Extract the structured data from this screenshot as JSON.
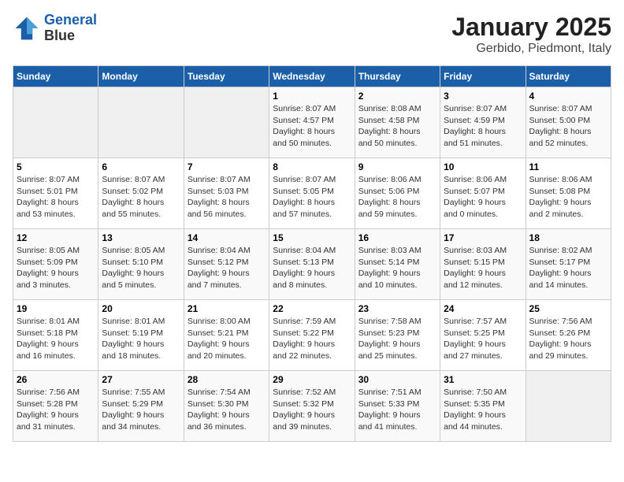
{
  "header": {
    "logo_line1": "General",
    "logo_line2": "Blue",
    "month": "January 2025",
    "location": "Gerbido, Piedmont, Italy"
  },
  "weekdays": [
    "Sunday",
    "Monday",
    "Tuesday",
    "Wednesday",
    "Thursday",
    "Friday",
    "Saturday"
  ],
  "weeks": [
    [
      {
        "day": "",
        "info": ""
      },
      {
        "day": "",
        "info": ""
      },
      {
        "day": "",
        "info": ""
      },
      {
        "day": "1",
        "info": "Sunrise: 8:07 AM\nSunset: 4:57 PM\nDaylight: 8 hours\nand 50 minutes."
      },
      {
        "day": "2",
        "info": "Sunrise: 8:08 AM\nSunset: 4:58 PM\nDaylight: 8 hours\nand 50 minutes."
      },
      {
        "day": "3",
        "info": "Sunrise: 8:07 AM\nSunset: 4:59 PM\nDaylight: 8 hours\nand 51 minutes."
      },
      {
        "day": "4",
        "info": "Sunrise: 8:07 AM\nSunset: 5:00 PM\nDaylight: 8 hours\nand 52 minutes."
      }
    ],
    [
      {
        "day": "5",
        "info": "Sunrise: 8:07 AM\nSunset: 5:01 PM\nDaylight: 8 hours\nand 53 minutes."
      },
      {
        "day": "6",
        "info": "Sunrise: 8:07 AM\nSunset: 5:02 PM\nDaylight: 8 hours\nand 55 minutes."
      },
      {
        "day": "7",
        "info": "Sunrise: 8:07 AM\nSunset: 5:03 PM\nDaylight: 8 hours\nand 56 minutes."
      },
      {
        "day": "8",
        "info": "Sunrise: 8:07 AM\nSunset: 5:05 PM\nDaylight: 8 hours\nand 57 minutes."
      },
      {
        "day": "9",
        "info": "Sunrise: 8:06 AM\nSunset: 5:06 PM\nDaylight: 8 hours\nand 59 minutes."
      },
      {
        "day": "10",
        "info": "Sunrise: 8:06 AM\nSunset: 5:07 PM\nDaylight: 9 hours\nand 0 minutes."
      },
      {
        "day": "11",
        "info": "Sunrise: 8:06 AM\nSunset: 5:08 PM\nDaylight: 9 hours\nand 2 minutes."
      }
    ],
    [
      {
        "day": "12",
        "info": "Sunrise: 8:05 AM\nSunset: 5:09 PM\nDaylight: 9 hours\nand 3 minutes."
      },
      {
        "day": "13",
        "info": "Sunrise: 8:05 AM\nSunset: 5:10 PM\nDaylight: 9 hours\nand 5 minutes."
      },
      {
        "day": "14",
        "info": "Sunrise: 8:04 AM\nSunset: 5:12 PM\nDaylight: 9 hours\nand 7 minutes."
      },
      {
        "day": "15",
        "info": "Sunrise: 8:04 AM\nSunset: 5:13 PM\nDaylight: 9 hours\nand 8 minutes."
      },
      {
        "day": "16",
        "info": "Sunrise: 8:03 AM\nSunset: 5:14 PM\nDaylight: 9 hours\nand 10 minutes."
      },
      {
        "day": "17",
        "info": "Sunrise: 8:03 AM\nSunset: 5:15 PM\nDaylight: 9 hours\nand 12 minutes."
      },
      {
        "day": "18",
        "info": "Sunrise: 8:02 AM\nSunset: 5:17 PM\nDaylight: 9 hours\nand 14 minutes."
      }
    ],
    [
      {
        "day": "19",
        "info": "Sunrise: 8:01 AM\nSunset: 5:18 PM\nDaylight: 9 hours\nand 16 minutes."
      },
      {
        "day": "20",
        "info": "Sunrise: 8:01 AM\nSunset: 5:19 PM\nDaylight: 9 hours\nand 18 minutes."
      },
      {
        "day": "21",
        "info": "Sunrise: 8:00 AM\nSunset: 5:21 PM\nDaylight: 9 hours\nand 20 minutes."
      },
      {
        "day": "22",
        "info": "Sunrise: 7:59 AM\nSunset: 5:22 PM\nDaylight: 9 hours\nand 22 minutes."
      },
      {
        "day": "23",
        "info": "Sunrise: 7:58 AM\nSunset: 5:23 PM\nDaylight: 9 hours\nand 25 minutes."
      },
      {
        "day": "24",
        "info": "Sunrise: 7:57 AM\nSunset: 5:25 PM\nDaylight: 9 hours\nand 27 minutes."
      },
      {
        "day": "25",
        "info": "Sunrise: 7:56 AM\nSunset: 5:26 PM\nDaylight: 9 hours\nand 29 minutes."
      }
    ],
    [
      {
        "day": "26",
        "info": "Sunrise: 7:56 AM\nSunset: 5:28 PM\nDaylight: 9 hours\nand 31 minutes."
      },
      {
        "day": "27",
        "info": "Sunrise: 7:55 AM\nSunset: 5:29 PM\nDaylight: 9 hours\nand 34 minutes."
      },
      {
        "day": "28",
        "info": "Sunrise: 7:54 AM\nSunset: 5:30 PM\nDaylight: 9 hours\nand 36 minutes."
      },
      {
        "day": "29",
        "info": "Sunrise: 7:52 AM\nSunset: 5:32 PM\nDaylight: 9 hours\nand 39 minutes."
      },
      {
        "day": "30",
        "info": "Sunrise: 7:51 AM\nSunset: 5:33 PM\nDaylight: 9 hours\nand 41 minutes."
      },
      {
        "day": "31",
        "info": "Sunrise: 7:50 AM\nSunset: 5:35 PM\nDaylight: 9 hours\nand 44 minutes."
      },
      {
        "day": "",
        "info": ""
      }
    ]
  ]
}
